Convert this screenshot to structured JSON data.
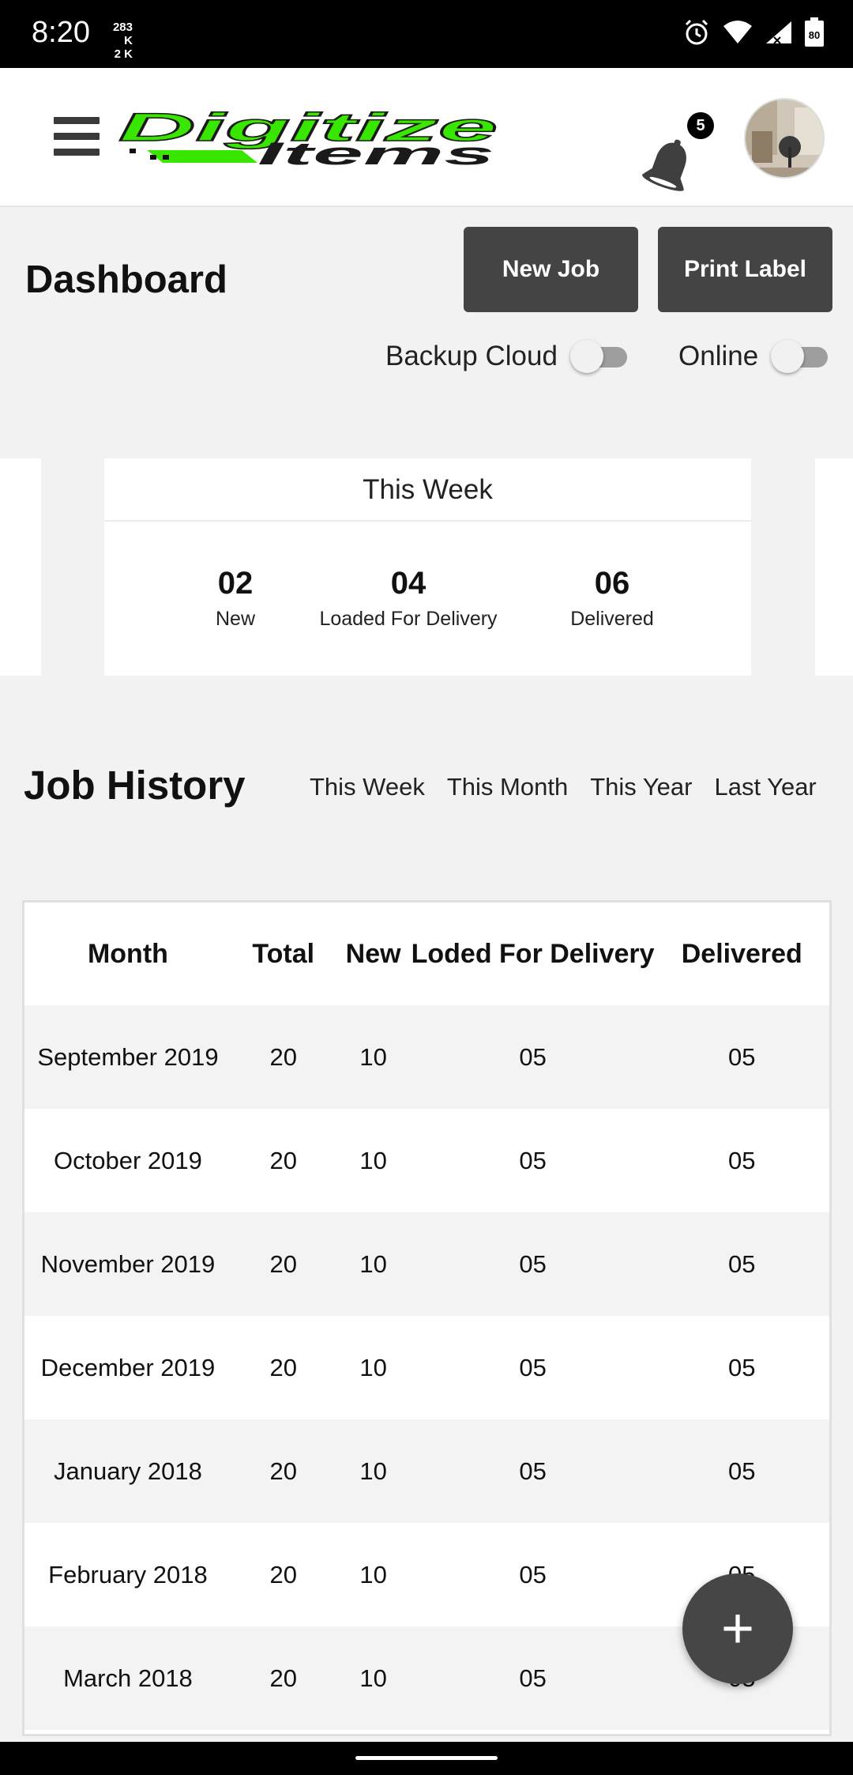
{
  "status_bar": {
    "time": "8:20",
    "net_speed_up": "283 K",
    "net_speed_down": "2 K",
    "battery": "80",
    "icons": [
      "alarm-icon",
      "wifi-icon",
      "signal-icon",
      "battery-icon"
    ]
  },
  "app_bar": {
    "logo_text_top": "Digitize",
    "logo_text_bottom": "Items",
    "notification_count": "5",
    "logo_color": "#39e600"
  },
  "dashboard": {
    "title": "Dashboard",
    "new_job_label": "New Job",
    "print_label_label": "Print Label",
    "backup_cloud_label": "Backup Cloud",
    "online_label": "Online"
  },
  "stats": {
    "title": "This Week",
    "items": [
      {
        "value": "02",
        "label": "New"
      },
      {
        "value": "04",
        "label": "Loaded For Delivery"
      },
      {
        "value": "06",
        "label": "Delivered"
      }
    ]
  },
  "job_history": {
    "title": "Job History",
    "periods": [
      "This Week",
      "This Month",
      "This Year",
      "Last Year"
    ],
    "columns": [
      "Month",
      "Total",
      "New",
      "Loded For Delivery",
      "Delivered"
    ],
    "rows": [
      [
        "September 2019",
        "20",
        "10",
        "05",
        "05"
      ],
      [
        "October 2019",
        "20",
        "10",
        "05",
        "05"
      ],
      [
        "November 2019",
        "20",
        "10",
        "05",
        "05"
      ],
      [
        "December 2019",
        "20",
        "10",
        "05",
        "05"
      ],
      [
        "January 2018",
        "20",
        "10",
        "05",
        "05"
      ],
      [
        "February 2018",
        "20",
        "10",
        "05",
        "05"
      ],
      [
        "March 2018",
        "20",
        "10",
        "05",
        "05"
      ]
    ]
  },
  "fab": {
    "symbol": "+"
  }
}
